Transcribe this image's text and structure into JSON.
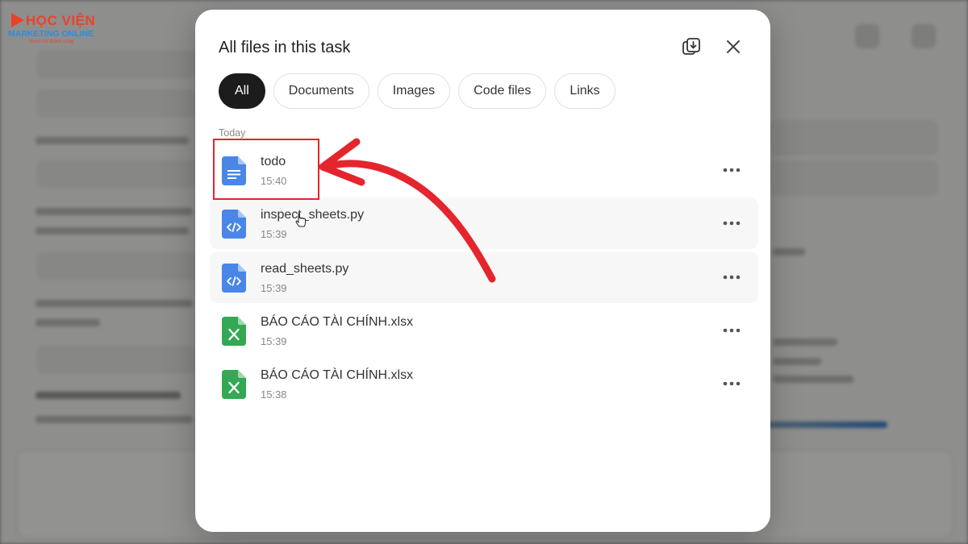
{
  "logo": {
    "line1": "HỌC VIỆN",
    "line2": "MARKETING ONLINE",
    "line3": "Vươn tới thành công"
  },
  "modal": {
    "title": "All files in this task",
    "download_icon": "download-all-icon",
    "close_icon": "close-icon",
    "tabs": [
      {
        "label": "All",
        "active": true
      },
      {
        "label": "Documents",
        "active": false
      },
      {
        "label": "Images",
        "active": false
      },
      {
        "label": "Code files",
        "active": false
      },
      {
        "label": "Links",
        "active": false
      }
    ],
    "section_label": "Today",
    "files": [
      {
        "name": "todo",
        "time": "15:40",
        "icon": "document-icon"
      },
      {
        "name": "inspect_sheets.py",
        "time": "15:39",
        "icon": "code-file-icon"
      },
      {
        "name": "read_sheets.py",
        "time": "15:39",
        "icon": "code-file-icon"
      },
      {
        "name": "BÁO CÁO TÀI CHÍNH.xlsx",
        "time": "15:39",
        "icon": "spreadsheet-icon"
      },
      {
        "name": "BÁO CÁO TÀI CHÍNH.xlsx",
        "time": "15:38",
        "icon": "spreadsheet-icon"
      }
    ]
  },
  "colors": {
    "doc_blue": "#4a86e8",
    "sheet_green": "#34a853",
    "annotation_red": "#e5252d",
    "active_tab": "#1c1c1c"
  }
}
